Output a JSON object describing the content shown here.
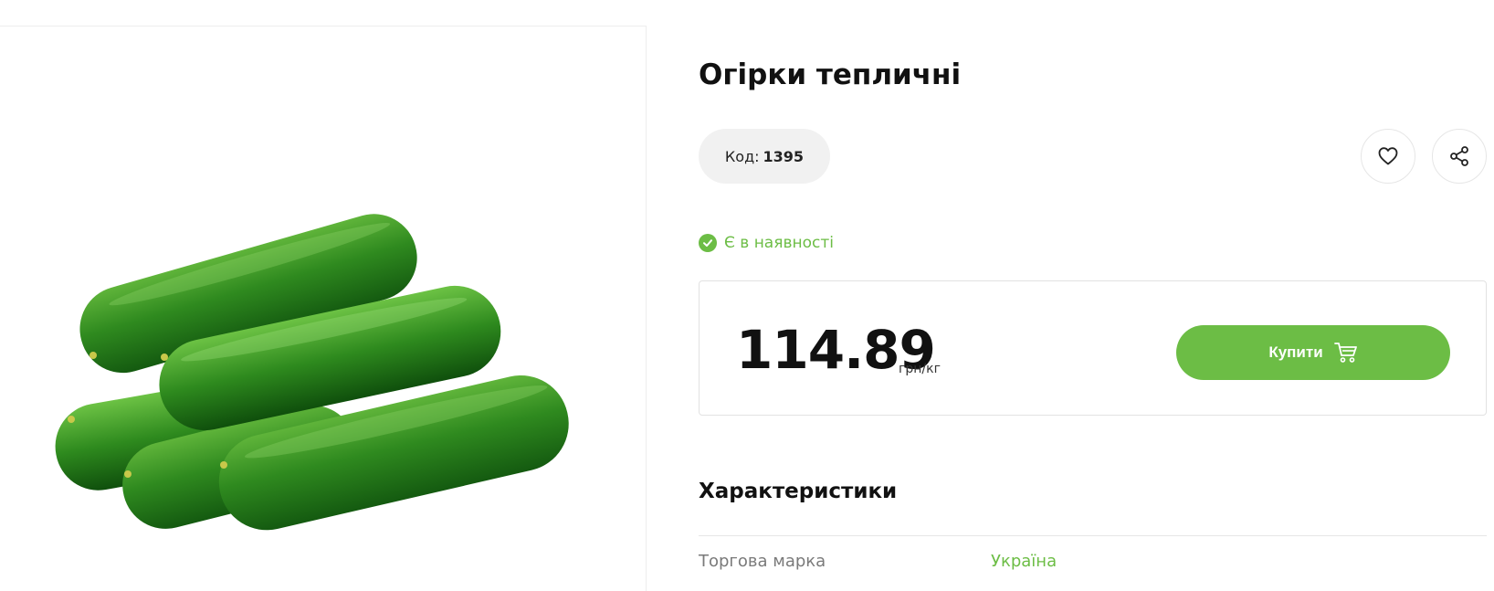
{
  "product": {
    "title": "Огірки тепличні",
    "code_label": "Код:",
    "code_value": "1395",
    "availability": "Є в наявності"
  },
  "price": {
    "value": "114.89",
    "unit": "грн/кг"
  },
  "actions": {
    "buy_label": "Купити",
    "favorite_icon": "heart-icon",
    "share_icon": "share-icon",
    "cart_icon": "cart-icon"
  },
  "characteristics": {
    "title": "Характеристики",
    "rows": [
      {
        "label": "Торгова марка",
        "value": "Україна"
      }
    ]
  },
  "colors": {
    "accent": "#6cbd45",
    "pill_bg": "#f1f1f1",
    "text": "#111111",
    "muted": "#7a7a7a"
  }
}
